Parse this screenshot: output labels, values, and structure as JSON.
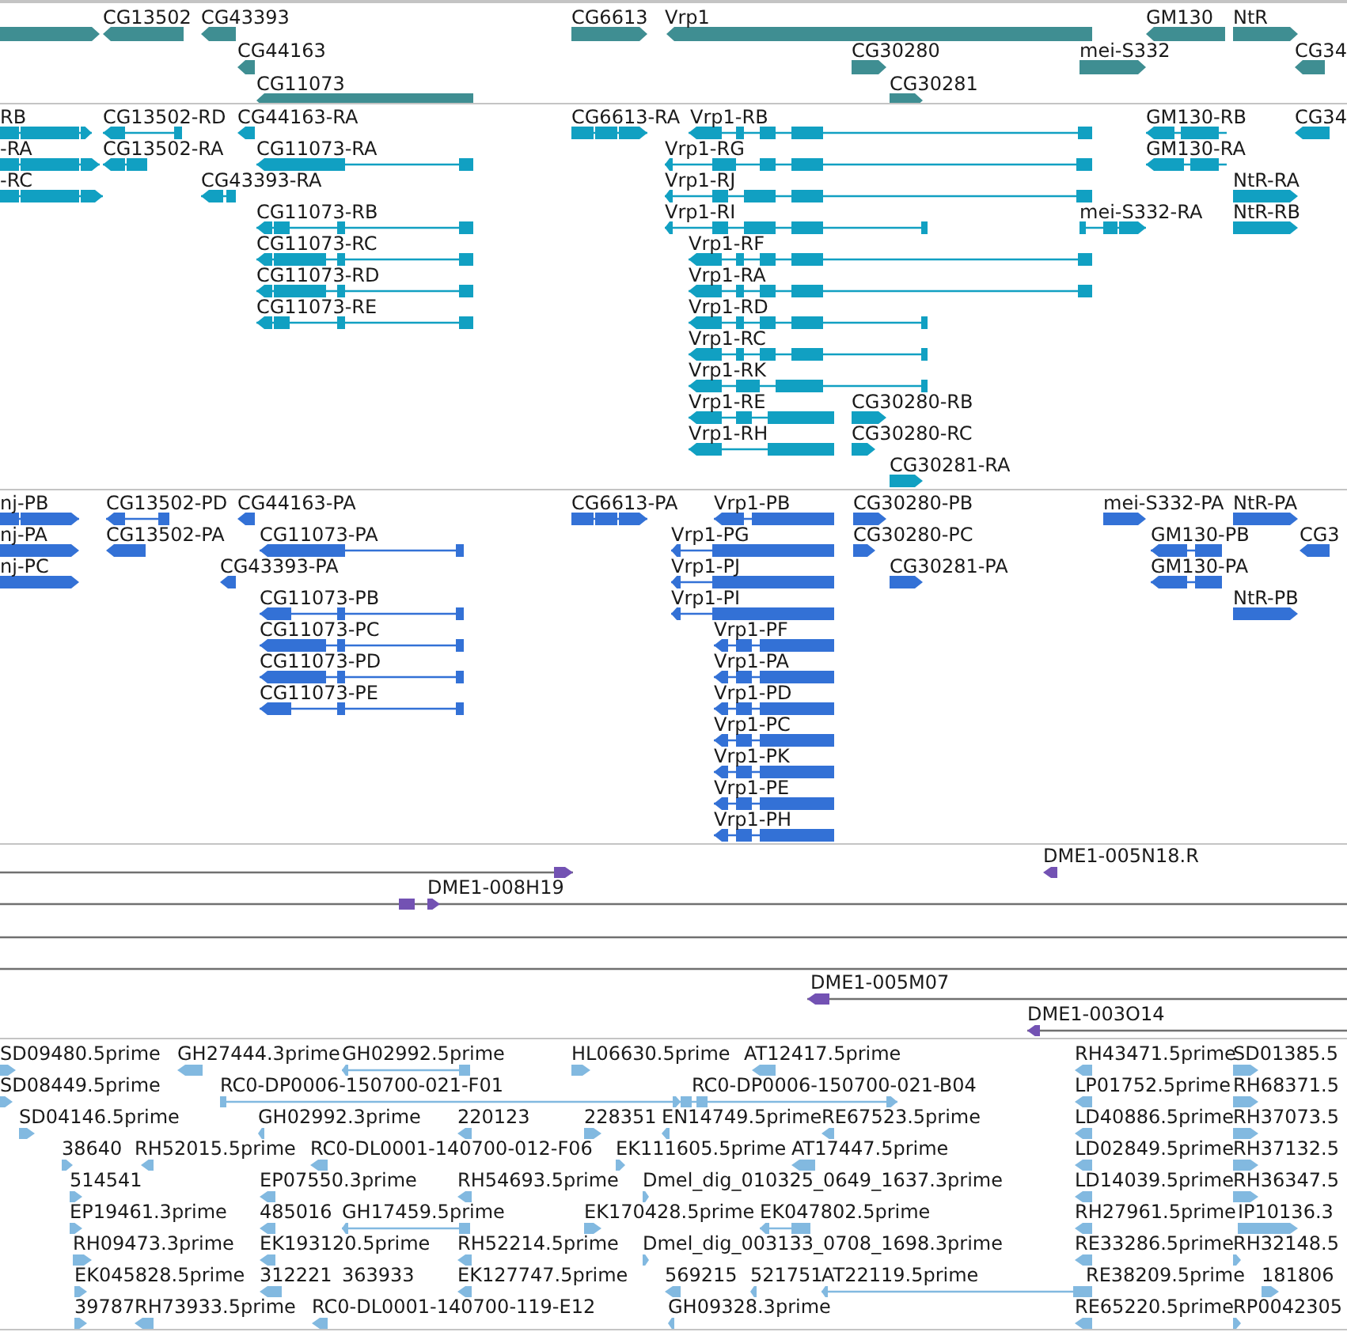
{
  "tracks": [
    {
      "features": [
        {
          "reverse": false
        },
        {
          "label": "CG13502",
          "reverse": true
        },
        {
          "label": "CG43393",
          "reverse": true
        },
        {
          "label": "CG6613",
          "reverse": false
        },
        {
          "label": "Vrp1",
          "reverse": true
        },
        {
          "label": "GM130",
          "reverse": true
        },
        {
          "label": "NtR",
          "reverse": false
        },
        {
          "label": "CG44163",
          "reverse": true
        },
        {
          "label": "CG30280",
          "reverse": false
        },
        {
          "label": "mei-S332",
          "reverse": false
        },
        {
          "label": "CG34",
          "reverse": true
        },
        {
          "label": "CG11073",
          "reverse": true
        },
        {
          "label": "CG30281",
          "reverse": false
        }
      ]
    },
    {
      "features": [
        {
          "label": "RB",
          "reverse": false
        },
        {
          "label": "CG13502-RD",
          "reverse": true
        },
        {
          "label": "CG44163-RA",
          "reverse": true
        },
        {
          "label": "CG6613-RA",
          "reverse": false
        },
        {
          "label": "Vrp1-RB",
          "reverse": true
        },
        {
          "label": "GM130-RB",
          "reverse": true
        },
        {
          "label": "CG34",
          "reverse": true
        },
        {
          "label": "-RA",
          "reverse": false
        },
        {
          "label": "CG13502-RA",
          "reverse": true
        },
        {
          "label": "CG11073-RA",
          "reverse": true
        },
        {
          "label": "Vrp1-RG",
          "reverse": true
        },
        {
          "label": "GM130-RA",
          "reverse": true
        },
        {
          "label": "-RC",
          "reverse": false
        },
        {
          "label": "CG43393-RA",
          "reverse": true
        },
        {
          "label": "Vrp1-RJ",
          "reverse": true
        },
        {
          "label": "NtR-RA",
          "reverse": false
        },
        {
          "label": "CG11073-RB",
          "reverse": true
        },
        {
          "label": "Vrp1-RI",
          "reverse": true
        },
        {
          "label": "mei-S332-RA",
          "reverse": false
        },
        {
          "label": "NtR-RB",
          "reverse": false
        },
        {
          "label": "CG11073-RC",
          "reverse": true
        },
        {
          "label": "Vrp1-RF",
          "reverse": true
        },
        {
          "label": "CG11073-RD",
          "reverse": true
        },
        {
          "label": "Vrp1-RA",
          "reverse": true
        },
        {
          "label": "CG11073-RE",
          "reverse": true
        },
        {
          "label": "Vrp1-RD",
          "reverse": true
        },
        {
          "label": "Vrp1-RC",
          "reverse": true
        },
        {
          "label": "Vrp1-RK",
          "reverse": true
        },
        {
          "label": "Vrp1-RE",
          "reverse": true
        },
        {
          "label": "CG30280-RB",
          "reverse": false
        },
        {
          "label": "Vrp1-RH",
          "reverse": true
        },
        {
          "label": "CG30280-RC",
          "reverse": false
        },
        {
          "label": "CG30281-RA",
          "reverse": false
        }
      ]
    },
    {
      "features": [
        {
          "label": "nj-PB",
          "reverse": false
        },
        {
          "label": "CG13502-PD",
          "reverse": true
        },
        {
          "label": "CG44163-PA",
          "reverse": true
        },
        {
          "label": "CG6613-PA",
          "reverse": false
        },
        {
          "label": "Vrp1-PB",
          "reverse": true
        },
        {
          "label": "CG30280-PB",
          "reverse": false
        },
        {
          "label": "mei-S332-PA",
          "reverse": false
        },
        {
          "label": "NtR-PA",
          "reverse": false
        },
        {
          "label": "nj-PA",
          "reverse": false
        },
        {
          "label": "CG13502-PA",
          "reverse": true
        },
        {
          "label": "CG11073-PA",
          "reverse": true
        },
        {
          "label": "Vrp1-PG",
          "reverse": true
        },
        {
          "label": "CG30280-PC",
          "reverse": false
        },
        {
          "label": "GM130-PB",
          "reverse": true
        },
        {
          "label": "CG3",
          "reverse": true
        },
        {
          "label": "nj-PC",
          "reverse": false
        },
        {
          "label": "CG43393-PA",
          "reverse": true
        },
        {
          "label": "Vrp1-PJ",
          "reverse": true
        },
        {
          "label": "CG30281-PA",
          "reverse": false
        },
        {
          "label": "GM130-PA",
          "reverse": true
        },
        {
          "label": "CG11073-PB",
          "reverse": true
        },
        {
          "label": "Vrp1-PI",
          "reverse": true
        },
        {
          "label": "NtR-PB",
          "reverse": false
        },
        {
          "label": "CG11073-PC",
          "reverse": true
        },
        {
          "label": "Vrp1-PF",
          "reverse": true
        },
        {
          "label": "CG11073-PD",
          "reverse": true
        },
        {
          "label": "Vrp1-PA",
          "reverse": true
        },
        {
          "label": "CG11073-PE",
          "reverse": true
        },
        {
          "label": "Vrp1-PD",
          "reverse": true
        },
        {
          "label": "Vrp1-PC",
          "reverse": true
        },
        {
          "label": "Vrp1-PK",
          "reverse": true
        },
        {
          "label": "Vrp1-PE",
          "reverse": true
        },
        {
          "label": "Vrp1-PH",
          "reverse": true
        }
      ]
    },
    {
      "features": [
        {
          "kind": "clone",
          "reverse": false
        },
        {
          "kind": "clone",
          "label": "DME1-005N18.R",
          "reverse": true
        },
        {
          "kind": "clone",
          "label": "DME1-008H19",
          "reverse": false
        },
        {
          "kind": "line"
        },
        {
          "kind": "line"
        },
        {
          "kind": "clone",
          "label": "DME1-005M07",
          "reverse": true
        },
        {
          "kind": "clone",
          "label": "DME1-003O14",
          "reverse": true
        }
      ]
    },
    {
      "features": [
        {
          "label": "SD09480.5prime",
          "reverse": false
        },
        {
          "label": "GH27444.3prime",
          "reverse": true
        },
        {
          "label": "GH02992.5prime",
          "reverse": true
        },
        {
          "label": "HL06630.5prime",
          "reverse": false
        },
        {
          "label": "AT12417.5prime",
          "reverse": true
        },
        {
          "label": "RH43471.5prime",
          "reverse": true
        },
        {
          "label": "SD01385.5",
          "reverse": false
        },
        {
          "label": "SD08449.5prime",
          "reverse": false
        },
        {
          "label": "RC0-DP0006-150700-021-F01",
          "reverse": false
        },
        {
          "label": "RC0-DP0006-150700-021-B04",
          "reverse": false
        },
        {
          "label": "LP01752.5prime",
          "reverse": true
        },
        {
          "label": "RH68371.5",
          "reverse": false
        },
        {
          "label": "SD04146.5prime",
          "reverse": false
        },
        {
          "label": "GH02992.3prime",
          "reverse": true
        },
        {
          "label": "220123",
          "reverse": true
        },
        {
          "label": "228351",
          "reverse": false
        },
        {
          "label": "EN14749.5prime",
          "reverse": true
        },
        {
          "label": "RE67523.5prime",
          "reverse": true
        },
        {
          "label": "LD40886.5prime",
          "reverse": true
        },
        {
          "label": "RH37073.5",
          "reverse": false
        },
        {
          "label": "38640",
          "reverse": false
        },
        {
          "label": "RH52015.5prime",
          "reverse": true
        },
        {
          "label": "RC0-DL0001-140700-012-F06",
          "reverse": true
        },
        {
          "label": "EK111605.5prime",
          "reverse": false
        },
        {
          "label": "AT17447.5prime",
          "reverse": true
        },
        {
          "label": "LD02849.5prime",
          "reverse": true
        },
        {
          "label": "RH37132.5",
          "reverse": false
        },
        {
          "label": "514541",
          "reverse": false
        },
        {
          "label": "EP07550.3prime",
          "reverse": true
        },
        {
          "label": "RH54693.5prime",
          "reverse": true
        },
        {
          "label": "Dmel_dig_010325_0649_1637.3prime",
          "reverse": false
        },
        {
          "label": "LD14039.5prime",
          "reverse": true
        },
        {
          "label": "RH36347.5",
          "reverse": false
        },
        {
          "label": "EP19461.3prime",
          "reverse": false
        },
        {
          "label": "485016",
          "reverse": true
        },
        {
          "label": "GH17459.5prime",
          "reverse": true
        },
        {
          "label": "EK170428.5prime",
          "reverse": false
        },
        {
          "label": "EK047802.5prime",
          "reverse": true
        },
        {
          "label": "RH27961.5prime",
          "reverse": true
        },
        {
          "label": "IP10136.3",
          "reverse": false
        },
        {
          "label": "RH09473.3prime",
          "reverse": false
        },
        {
          "label": "EK193120.5prime",
          "reverse": true
        },
        {
          "label": "RH52214.5prime",
          "reverse": true
        },
        {
          "label": "Dmel_dig_003133_0708_1698.3prime",
          "reverse": false
        },
        {
          "label": "RE33286.5prime",
          "reverse": true
        },
        {
          "label": "RH32148.5",
          "reverse": false
        },
        {
          "label": "EK045828.5prime",
          "reverse": false
        },
        {
          "label": "312221",
          "reverse": true
        },
        {
          "label": "363933"
        },
        {
          "label": "EK127747.5prime",
          "reverse": true
        },
        {
          "label": "569215",
          "reverse": true
        },
        {
          "label": "521751",
          "reverse": true
        },
        {
          "label": "AT22119.5prime",
          "reverse": true
        },
        {
          "label": "RE38209.5prime"
        },
        {
          "label": "181806",
          "reverse": false
        },
        {
          "label": "39787",
          "reverse": false
        },
        {
          "label": "RH73933.5prime",
          "reverse": true
        },
        {
          "label": "RC0-DL0001-140700-119-E12",
          "reverse": true
        },
        {
          "label": "GH09328.3prime",
          "reverse": true
        },
        {
          "label": "RE65220.5prime",
          "reverse": true
        },
        {
          "label": "RP0042305",
          "reverse": false
        }
      ]
    }
  ]
}
